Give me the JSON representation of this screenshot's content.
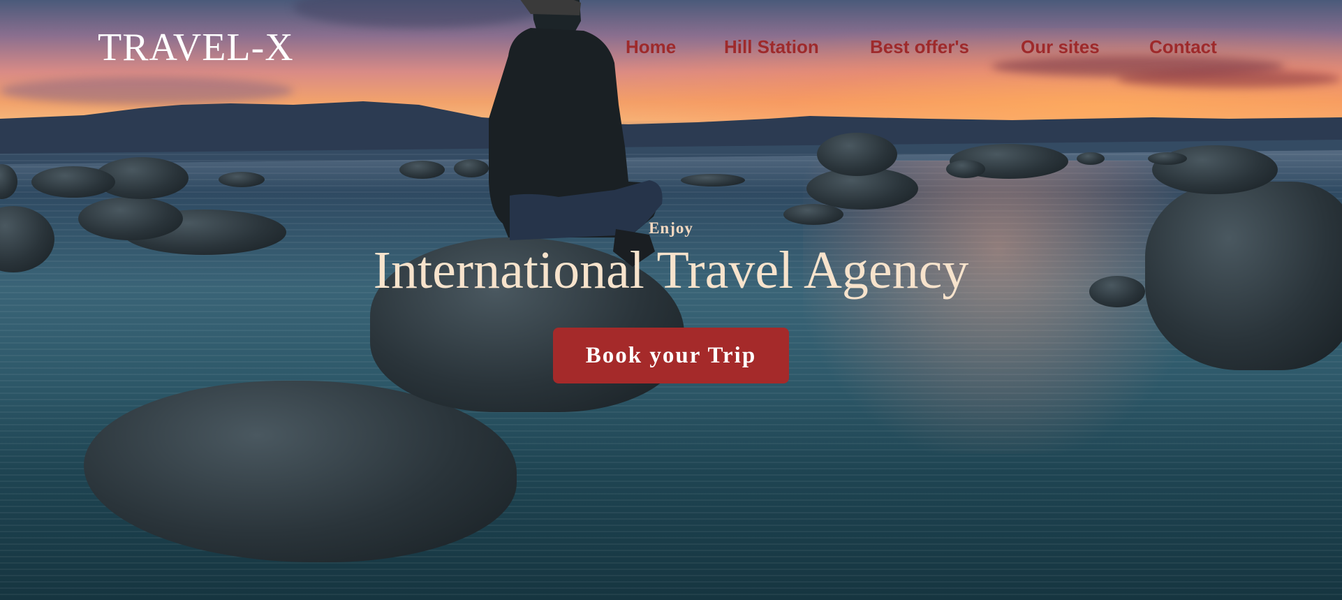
{
  "brand": {
    "logo_text": "TRAVEL-X"
  },
  "nav": {
    "items": [
      {
        "label": "Home"
      },
      {
        "label": "Hill Station"
      },
      {
        "label": "Best offer's"
      },
      {
        "label": "Our sites"
      },
      {
        "label": "Contact"
      }
    ]
  },
  "hero": {
    "kicker": "Enjoy",
    "headline": "International Travel Agency",
    "cta_label": "Book your Trip",
    "background_description_icon": "lake-sunset-photo"
  },
  "colors": {
    "nav_text": "#9e2a2b",
    "cta_background": "#a52a2a",
    "logo_text": "#ffffff",
    "headline_text": "#f7e3cc"
  }
}
